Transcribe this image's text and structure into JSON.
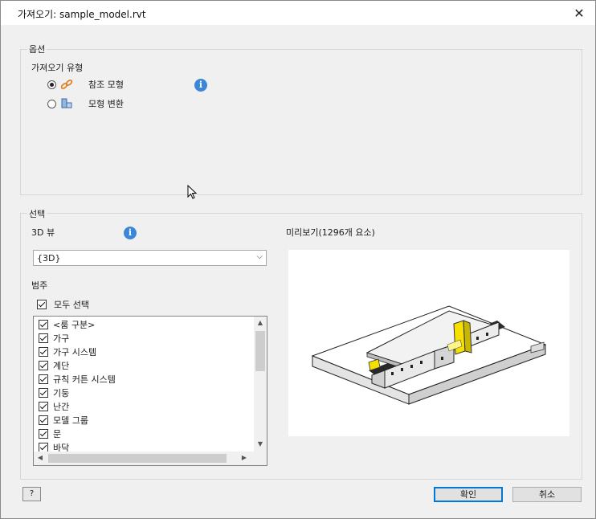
{
  "window": {
    "title": "가져오기: sample_model.rvt",
    "close_glyph": "✕"
  },
  "options": {
    "group_label": "옵션",
    "import_type_label": "가져오기 유형",
    "choices": [
      {
        "label": "참조 모형",
        "selected": true,
        "icon": "link-icon"
      },
      {
        "label": "모형 변환",
        "selected": false,
        "icon": "convert-model-icon"
      }
    ],
    "info_glyph": "i"
  },
  "selection": {
    "group_label": "선택",
    "view_label": "3D 뷰",
    "view_value": "{3D}",
    "preview_label": "미리보기(1296개 요소)",
    "category_label": "범주",
    "select_all_label": "모두 선택",
    "select_all_checked": true,
    "categories": [
      {
        "label": "<룸 구분>",
        "checked": true
      },
      {
        "label": "가구",
        "checked": true
      },
      {
        "label": "가구 시스템",
        "checked": true
      },
      {
        "label": "계단",
        "checked": true
      },
      {
        "label": "규칙 커튼 시스템",
        "checked": true
      },
      {
        "label": "기둥",
        "checked": true
      },
      {
        "label": "난간",
        "checked": true
      },
      {
        "label": "모델 그룹",
        "checked": true
      },
      {
        "label": "문",
        "checked": true
      },
      {
        "label": "바닥",
        "checked": true
      }
    ]
  },
  "footer": {
    "help_glyph": "?",
    "ok_label": "확인",
    "cancel_label": "취소"
  },
  "colors": {
    "accent": "#0078d7",
    "info": "#3a87d8",
    "highlight": "#f5e000"
  }
}
